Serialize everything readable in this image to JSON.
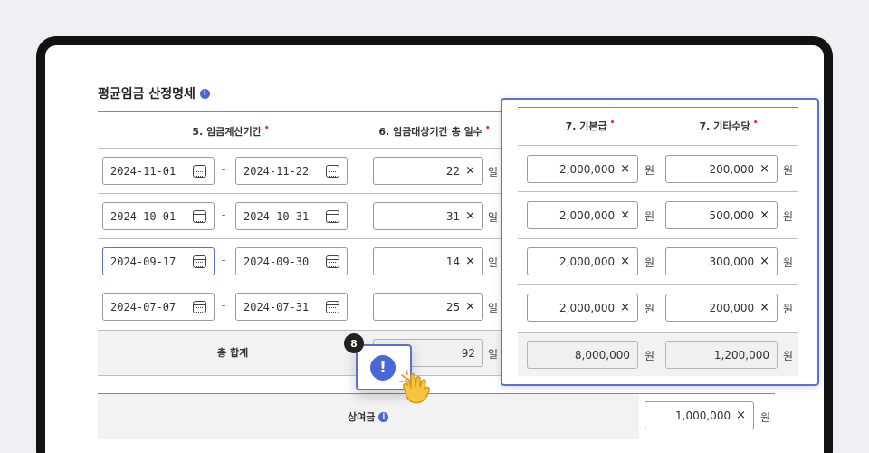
{
  "section": {
    "title": "평균임금 산정명세"
  },
  "headers": {
    "period": "5. 임금계산기간",
    "days": "6. 임금대상기간 총 일수",
    "base_pay": "7. 기본급",
    "other_allowance": "7. 기타수당",
    "required_mark": "•"
  },
  "rows": [
    {
      "start": "2024-11-01",
      "end": "2024-11-22",
      "days": "22",
      "base": "2,000,000",
      "other": "200,000"
    },
    {
      "start": "2024-10-01",
      "end": "2024-10-31",
      "days": "31",
      "base": "2,000,000",
      "other": "500,000"
    },
    {
      "start": "2024-09-17",
      "end": "2024-09-30",
      "days": "14",
      "base": "2,000,000",
      "other": "300,000"
    },
    {
      "start": "2024-07-07",
      "end": "2024-07-31",
      "days": "25",
      "base": "2,000,000",
      "other": "200,000"
    }
  ],
  "total": {
    "label": "총 합계",
    "days": "92",
    "base": "8,000,000",
    "other": "1,200,000"
  },
  "bonus": {
    "label": "상여금",
    "value": "1,000,000"
  },
  "units": {
    "day": "일",
    "won": "원",
    "dash": "-",
    "clear": "×"
  },
  "step_badge": "8",
  "alert_symbol": "!",
  "colors": {
    "accent": "#5b6fd6",
    "required": "#e0245e",
    "info": "#4a67d6"
  }
}
